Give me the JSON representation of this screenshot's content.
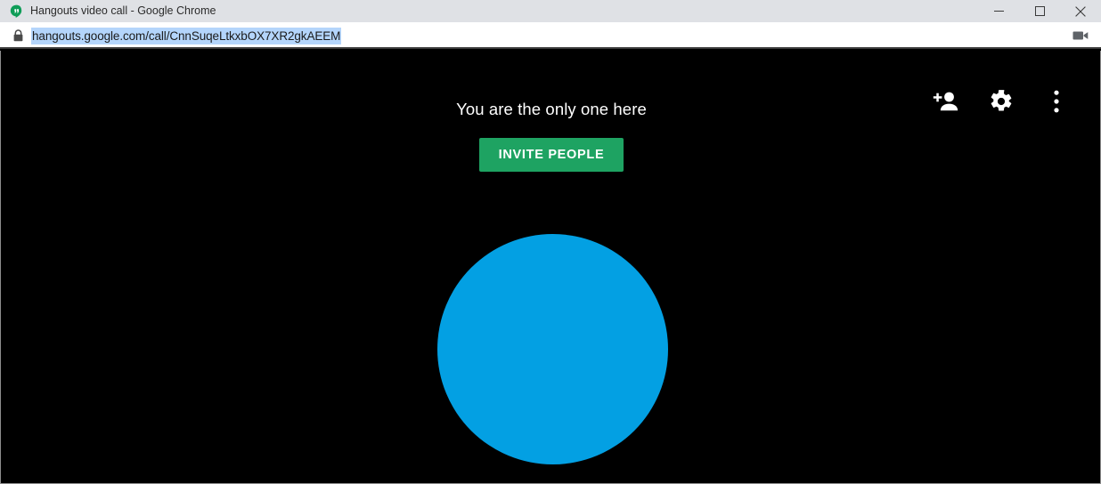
{
  "window": {
    "title": "Hangouts video call - Google Chrome",
    "favicon_icon": "hangouts-icon",
    "controls": {
      "minimize_label": "Minimize",
      "maximize_label": "Maximize",
      "close_label": "Close"
    }
  },
  "omnibox": {
    "security_icon": "lock-icon",
    "url": "hangouts.google.com/call/CnnSuqeLtkxbOX7XR2gkAEEM",
    "url_selected": true,
    "selection_color": "#b4d5fb",
    "media_indicator_icon": "video-camera-icon"
  },
  "call": {
    "background_color": "#000000",
    "status_text": "You are the only one here",
    "invite_button_label": "INVITE PEOPLE",
    "invite_button_color": "#1ea362",
    "avatar": {
      "icon": "avatar-circle",
      "color": "#03a0e3"
    },
    "actions": [
      {
        "name": "add-person-button",
        "icon": "add-person-icon",
        "label": "Add people"
      },
      {
        "name": "settings-button",
        "icon": "gear-icon",
        "label": "Settings"
      },
      {
        "name": "more-options-button",
        "icon": "more-vertical-icon",
        "label": "More options"
      }
    ]
  }
}
